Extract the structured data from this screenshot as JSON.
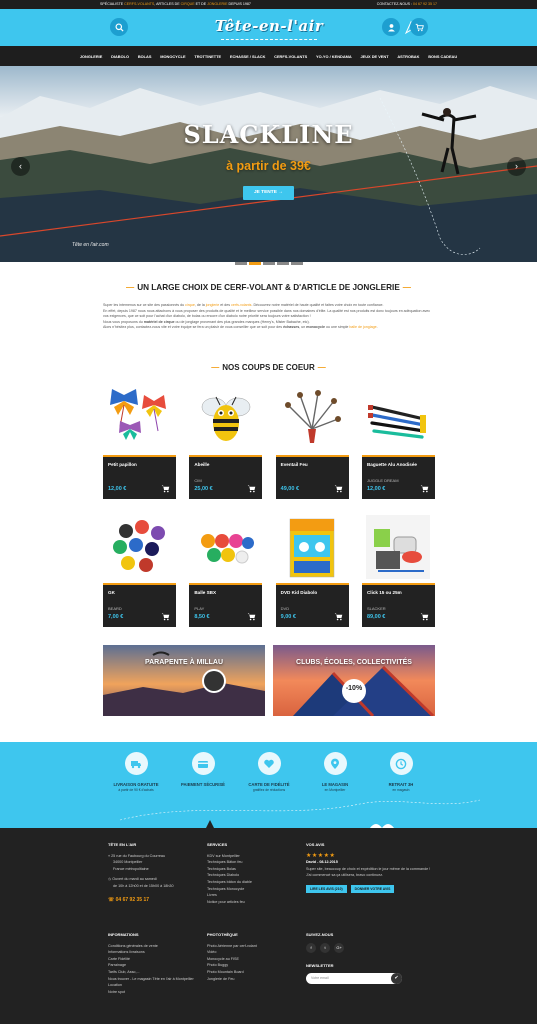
{
  "topbar": {
    "left_prefix": "SPÉCIALISTE",
    "left_hl1": "CERFS-VOLANTS",
    "left_mid": ", ARTICLES DE",
    "left_hl2": "CIRQUE",
    "left_mid2": "ET DE",
    "left_hl3": "JONGLERIE",
    "left_suffix": "DEPUIS 1987",
    "right_label": "CONTACTEZ-NOUS :",
    "right_phone": "04 67 92 35 17"
  },
  "header": {
    "logo": "Tête-en-l'air",
    "search_icon": "search-icon",
    "account_icon": "user-icon",
    "cart_icon": "cart-icon"
  },
  "nav": {
    "items": [
      "JONGLERIE",
      "DIABOLO",
      "BOLAS",
      "MONOCYCLE",
      "TROTTINETTE",
      "ECHASSE / SLACK",
      "CERFS-VOLANTS",
      "YO-YO / KENDAMA",
      "JEUX DE VENT",
      "ASTROBAK",
      "BONS CADEAU"
    ]
  },
  "hero": {
    "title": "SLACKLINE",
    "subtitle": "à partir de 39€",
    "button": "JE TENTE  →",
    "signature": "Tête en l'air.com",
    "prev": "‹",
    "next": "›",
    "slides": 5,
    "active_slide": 1
  },
  "intro": {
    "title": "UN LARGE CHOIX DE CERF-VOLANT & D'ARTICLE DE JONGLERIE",
    "p1a": "Super les intemenus sur ce site des passionnés du",
    "p1b": "cirque",
    "p1c": ", de la",
    "p1d": "jonglerie",
    "p1e": "et des",
    "p1f": "cerfs-volants",
    "p1g": ". Découvrez notre matériel de haute qualité et faites votre choix en toute confiance.",
    "p2": "En effet, depuis 1987 nous nous attachons à vous proposer des produits de qualité et le meilleur service possible dans nos domaines d'élite. La qualité est nos produits est donc toujours en adéquation avec vos exigences, que ce soit pour l'achat d'un diabolo, de bolas ou encore d'un diabolo notre priorité sera toujours votre satisfaction !",
    "p3a": "Nous vous proposons du",
    "p3b": "matériel de cirque",
    "p3c": "ou de jonglage provenant des plus grandes marques (Henry's, Mister Babache, etc).",
    "p4a": "Alors n'hésitez plus, contactez-nous vite et votre équipe se fera un plaisir de vous conseiller que ce soit pour des",
    "p4b": "échasses",
    "p4c": ", un",
    "p4d": "monocycle",
    "p4e": "ou une simple",
    "p4f": "balle de jonglage",
    "p4g": "."
  },
  "favorites": {
    "title": "NOS COUPS DE COEUR",
    "products": [
      {
        "name": "Petit papillon",
        "brand": "",
        "price": "12,00 €"
      },
      {
        "name": "Abeille",
        "brand": "CIM",
        "price": "25,00 €"
      },
      {
        "name": "Eventail Feu",
        "brand": "",
        "price": "49,00 €"
      },
      {
        "name": "Baguette Alu Anodisée",
        "brand": "JUGGLE DREAM",
        "price": "12,00 €"
      },
      {
        "name": "GK",
        "brand": "BEARD",
        "price": "7,00 €"
      },
      {
        "name": "Balle SBX",
        "brand": "PLAY",
        "price": "8,50 €"
      },
      {
        "name": "DVD Kid Diabolo",
        "brand": "DVD",
        "price": "9,00 €"
      },
      {
        "name": "Click 15 ou 25m",
        "brand": "SLACKER",
        "price": "89,00 €"
      }
    ]
  },
  "banners": {
    "left": "PARAPENTE À MILLAU",
    "right": "CLUBS, ÉCOLES, COLLECTIVITÉS",
    "discount": "-10%"
  },
  "features": [
    {
      "title": "LIVRAISON GRATUITE",
      "sub": "à partir de 90 € d'achats",
      "icon": "delivery-icon"
    },
    {
      "title": "PAIEMENT SÉCURISÉ",
      "sub": "",
      "icon": "card-icon"
    },
    {
      "title": "CARTE DE FIDÉLITÉ",
      "sub": "gratifiez de réductions",
      "icon": "heart-icon"
    },
    {
      "title": "LE MAGASIN",
      "sub": "en Montpellier",
      "icon": "location-icon"
    },
    {
      "title": "RETRAIT 3H",
      "sub": "en magasin",
      "icon": "clock-icon"
    }
  ],
  "footer": {
    "col1": {
      "title": "TÊTE EN L'AIR",
      "addr1": "25 rue du Faubourg du Courreau",
      "addr2": "34000 Montpellier",
      "addr3": "France métropolitaine",
      "hours1": "Ouvert du mardi au samedi",
      "hours2": "de 10h à 12h00 et de 15h00 à 18h30",
      "phone": "04 67 92 35 17"
    },
    "col1b": {
      "title": "INFORMATIONS",
      "links": [
        "Conditions générales de vente",
        "Informations livraisons",
        "Carte Fidélité",
        "Parrainage",
        "Tarifs Club, Asso,...",
        "Nous trouver - Le magasin Tête en l'air à Montpellier",
        "Location",
        "Notre spot"
      ]
    },
    "col2": {
      "title": "SERVICES",
      "links": [
        "KDV sur Montpellier",
        "Techniques Bâton feu",
        "Techniques Bolas",
        "Techniques Diabolo",
        "Techniques bâton du diable",
        "Techniques Monocycle",
        "Livres",
        "Notice pour articles feu"
      ]
    },
    "col2b": {
      "title": "PHOTOTHÈQUE",
      "links": [
        "Photo Aérienne par cerf-volant",
        "Vidéo",
        "Monocycle au FISE",
        "Photo Buggy",
        "Photo Mountain Board",
        "Jonglerie de Feu"
      ]
    },
    "col3": {
      "title": "VOS AVIS",
      "stars": "★★★★★",
      "reviewer": "David - 08.12.2015",
      "review": "Super site, beaucoup de choix et expédition le jour même de la commande ! J'ai commencé sa ça utilisera, bravo continuez.",
      "btn1": "LIRE LES AVIS (210)",
      "btn2": "DONNER VOTRE AVIS",
      "follow_title": "SUIVEZ-NOUS",
      "social": [
        "f",
        "t",
        "G+"
      ],
      "newsletter_title": "NEWSLETTER",
      "newsletter_placeholder": "Votre email",
      "newsletter_go": "✔"
    }
  }
}
